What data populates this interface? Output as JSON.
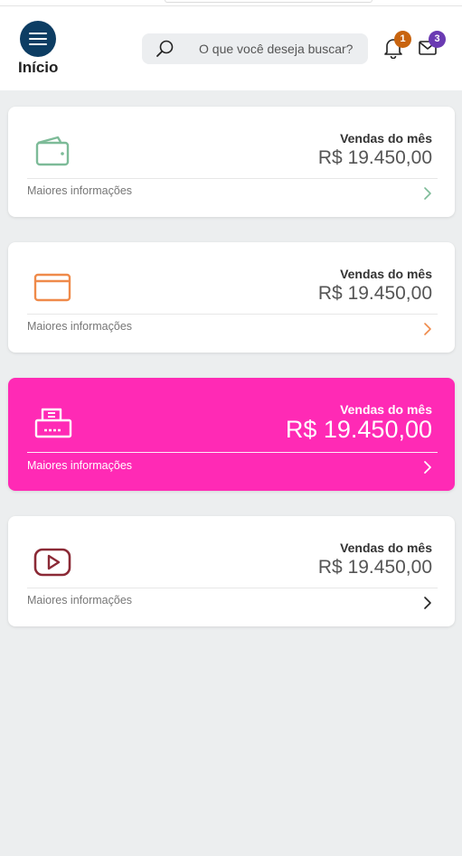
{
  "header": {
    "home_label": "Início",
    "search_placeholder": "O que você deseja buscar?",
    "notifications": {
      "icon": "bell-icon",
      "count": "1",
      "badge_color": "#c8640f"
    },
    "messages": {
      "icon": "mail-icon",
      "count": "3",
      "badge_color": "#6a3ab2"
    },
    "menu_color": "#0d3d63"
  },
  "cards": [
    {
      "icon": "wallet-icon",
      "accent": "#7dbb98",
      "background": "#ffffff",
      "label": "Vendas do mês",
      "value": "R$ 19.450,00",
      "more": "Maiores informações"
    },
    {
      "icon": "credit-card-icon",
      "accent": "#ef8a4a",
      "background": "#ffffff",
      "label": "Vendas do mês",
      "value": "R$ 19.450,00",
      "more": "Maiores informações"
    },
    {
      "icon": "receipt-printer-icon",
      "accent": "#ffffff",
      "background": "#ff2ab5",
      "label": "Vendas do mês",
      "value": "R$ 19.450,00",
      "more": "Maiores informações"
    },
    {
      "icon": "play-video-icon",
      "accent": "#8b2a36",
      "background": "#ffffff",
      "label": "Vendas do mês",
      "value": "R$ 19.450,00",
      "more": "Maiores informações"
    }
  ]
}
